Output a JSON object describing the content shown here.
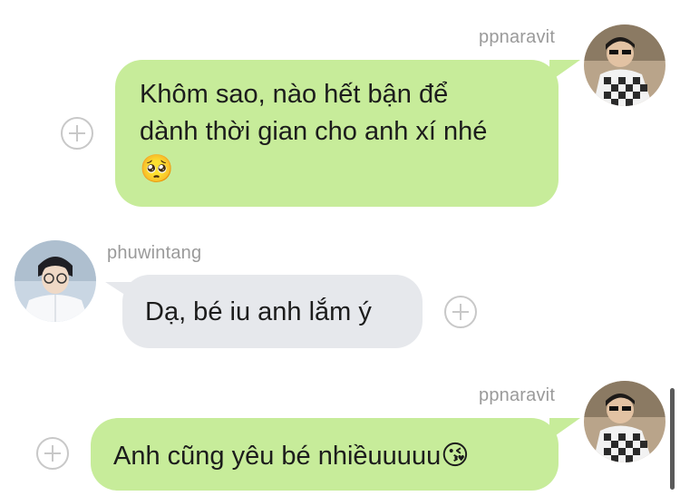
{
  "messages": [
    {
      "sender": "ppnaravit",
      "text_line1": "Khôm sao, nào hết bận để",
      "text_line2": "dành thời gian cho anh xí nhé",
      "emoji": "🥺",
      "avatar_icon": "avatar-ppnaravit"
    },
    {
      "sender": "phuwintang",
      "text": "Dạ, bé iu anh lắm ý",
      "avatar_icon": "avatar-phuwintang"
    },
    {
      "sender": "ppnaravit",
      "text": "Anh cũng yêu bé nhiềuuuuu",
      "emoji": "😘",
      "avatar_icon": "avatar-ppnaravit"
    }
  ],
  "colors": {
    "outgoing_bubble": "#c7ec9a",
    "incoming_bubble": "#e6e8ec",
    "username": "#9a9a9a",
    "reaction_button": "#c8c8c8"
  }
}
